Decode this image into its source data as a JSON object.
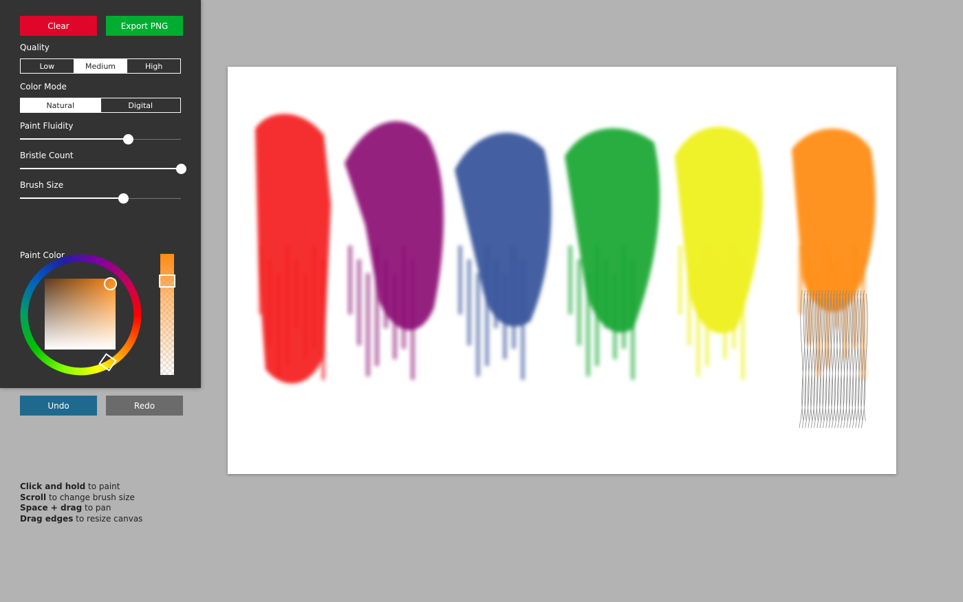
{
  "toolbar": {
    "clear_label": "Clear",
    "export_label": "Export PNG"
  },
  "quality": {
    "label": "Quality",
    "options": [
      "Low",
      "Medium",
      "High"
    ],
    "selected": "Medium"
  },
  "color_mode": {
    "label": "Color Mode",
    "options": [
      "Natural",
      "Digital"
    ],
    "selected": "Natural"
  },
  "sliders": {
    "paint_fluidity": {
      "label": "Paint Fluidity",
      "value": 0.67
    },
    "bristle_count": {
      "label": "Bristle Count",
      "value": 1.0
    },
    "brush_size": {
      "label": "Brush Size",
      "value": 0.64
    }
  },
  "paint_color": {
    "label": "Paint Color",
    "hex": "#ff8a12"
  },
  "history": {
    "undo_label": "Undo",
    "redo_label": "Redo"
  },
  "hints": [
    {
      "key": "Click and hold",
      "text": " to paint"
    },
    {
      "key": "Scroll",
      "text": " to change brush size"
    },
    {
      "key": "Space + drag",
      "text": " to pan"
    },
    {
      "key": "Drag edges",
      "text": " to resize canvas"
    }
  ],
  "colors": {
    "clear": "#e0062b",
    "export": "#00ad30",
    "undo": "#1e6a8f",
    "redo": "#6b6b6b",
    "panel": "#333333",
    "background": "#b3b3b3"
  },
  "strokes": [
    "#f41c1c",
    "#8c0f74",
    "#35539a",
    "#13a632",
    "#eef01a",
    "#ff8a12"
  ]
}
